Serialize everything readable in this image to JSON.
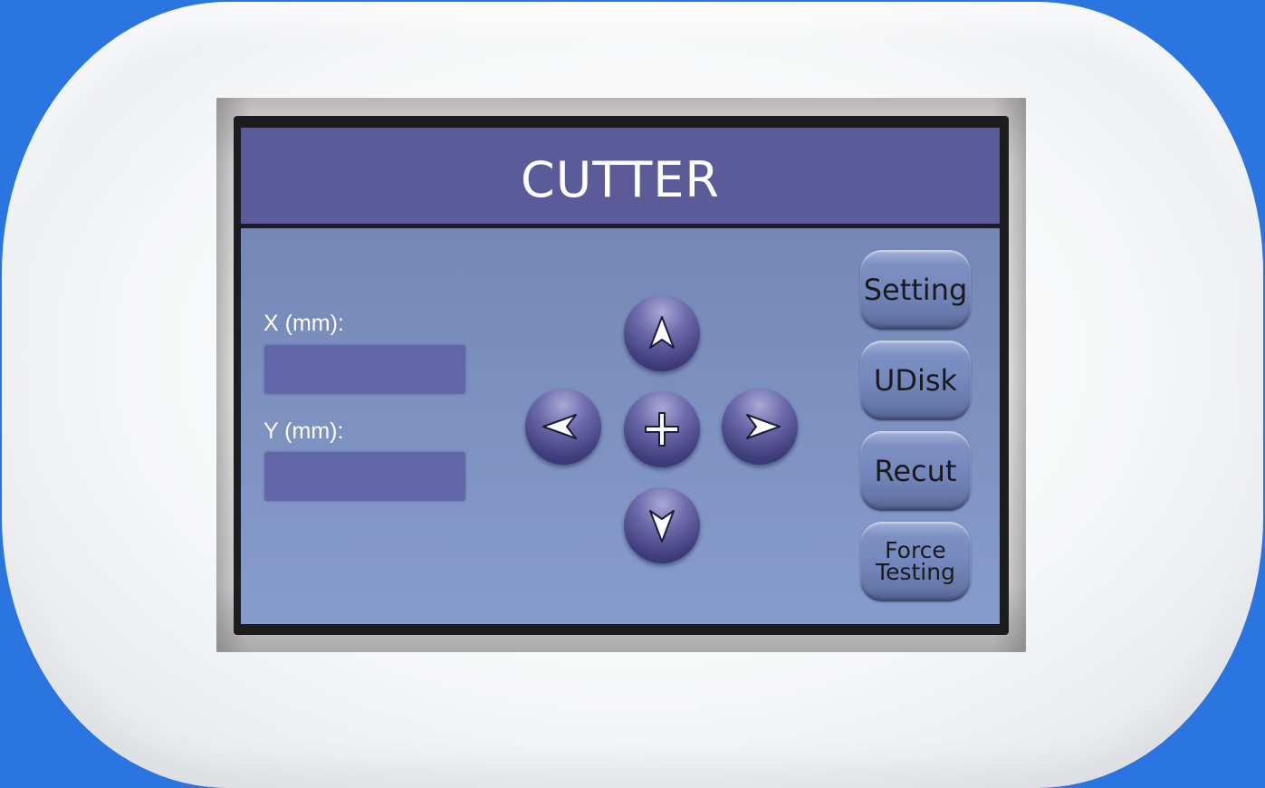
{
  "app": {
    "title": "CUTTER"
  },
  "position": {
    "x_label": "X (mm):",
    "x_value": "",
    "y_label": "Y (mm):",
    "y_value": ""
  },
  "jog": {
    "up_icon": "arrow-up-icon",
    "down_icon": "arrow-down-icon",
    "left_icon": "arrow-left-icon",
    "right_icon": "arrow-right-icon",
    "center_icon": "crosshair-plus-icon"
  },
  "side_buttons": {
    "setting": "Setting",
    "udisk": "UDisk",
    "recut": "Recut",
    "force_testing": "Force\nTesting"
  },
  "colors": {
    "background": "#2a75e0",
    "title_bar": "#5c5b9a",
    "panel": "#7f93c3",
    "field": "#6066a6",
    "jog_button": "#4e4c8e"
  }
}
